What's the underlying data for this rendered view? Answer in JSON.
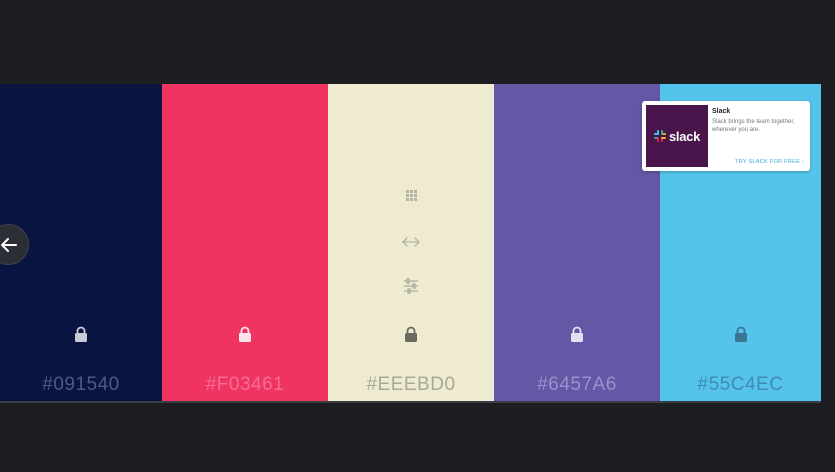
{
  "palette": [
    {
      "hex": "#091540",
      "bg": "#091540",
      "text_color": "#4d5a86",
      "icon_color": "#c9ccd6"
    },
    {
      "hex": "#F03461",
      "bg": "#F03461",
      "text_color": "#f66d91",
      "icon_color": "#ffe3ea"
    },
    {
      "hex": "#EEEBD0",
      "bg": "#EEEBD0",
      "text_color": "#a9a79a",
      "icon_color": "#6b6a63"
    },
    {
      "hex": "#6457A6",
      "bg": "#6457A6",
      "text_color": "#9a91cb",
      "icon_color": "#e3e0f2"
    },
    {
      "hex": "#55C4EC",
      "bg": "#55C4EC",
      "text_color": "#3f8cb0",
      "icon_color": "#3a7594"
    }
  ],
  "tools": [
    "grid-icon",
    "arrows-horizontal-icon",
    "sliders-icon"
  ],
  "ad": {
    "logo_text": "slack",
    "title": "Slack",
    "description": "Slack brings the team together, wherever you are.",
    "cta": "TRY SLACK FOR FREE ›"
  }
}
